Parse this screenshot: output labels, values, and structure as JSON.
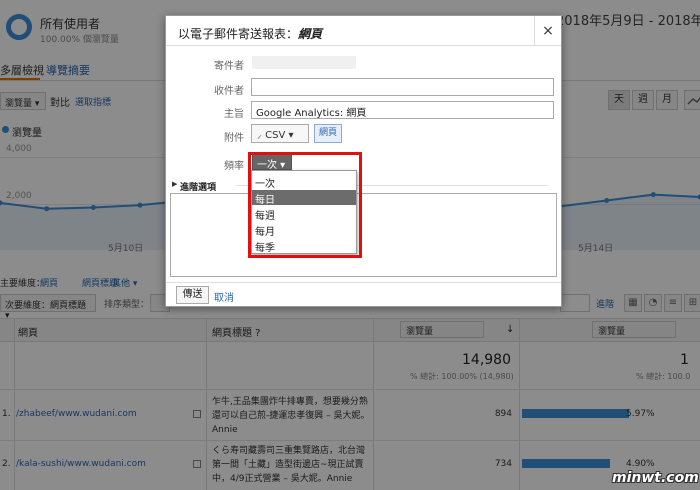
{
  "segment": {
    "name": "所有使用者",
    "subtitle": "100.00% 個瀏覽量"
  },
  "date_range": "2018年5月9日 - 2018年5月",
  "tabs": [
    {
      "label": "多層檢視"
    },
    {
      "label": "導覽摘要"
    }
  ],
  "controls": {
    "metric": "瀏覽量 ▾",
    "versus": "對比",
    "pick_metric": "選取指標"
  },
  "period_buttons": [
    "天",
    "週",
    "月"
  ],
  "chart": {
    "legend": "瀏覽量",
    "y_ticks": [
      "4,000",
      "2,000"
    ],
    "x_ticks": [
      "5月10日",
      "5月14日"
    ]
  },
  "chart_data": {
    "type": "line",
    "series": [
      {
        "name": "瀏覽量",
        "values": [
          2050,
          1800,
          1850,
          1950,
          2150,
          2000,
          1700,
          1900,
          2100,
          2000,
          2100,
          2300,
          1900,
          2150,
          2400,
          2300
        ]
      }
    ],
    "ylim": [
      0,
      4000
    ],
    "x_labels": [
      "5月10日",
      "5月14日"
    ]
  },
  "dimensions": {
    "primary": "主要維度：",
    "dim1": "網頁",
    "dim2": "網頁標題",
    "dim3": "其他 ▾"
  },
  "secondary": {
    "select": "次要維度：網頁標題 ▾",
    "sort_label": "排序類型："
  },
  "advanced_link": "進階",
  "table": {
    "headers": {
      "page": "網頁",
      "title": "網頁標題 ?",
      "metric1": "瀏覽量",
      "metric2": "瀏覽量"
    },
    "total": {
      "value": "14,980",
      "sub": "% 總計: 100.00% (14,980)",
      "sub2": "% 總計: 100.0"
    },
    "rows": [
      {
        "num": "1.",
        "page": "/zhabeef/www.wudani.com",
        "title": "乍牛,王品集團炸牛排專賣，想要幾分熟還可以自己煎-捷運忠孝復興 – 吳大妮。Annie",
        "value": "894",
        "pct": "5.97%",
        "bar": 0.597
      },
      {
        "num": "2.",
        "page": "/kala-sushi/www.wudani.com",
        "title": "くら寿司藏壽司三重集覽路店，北台灣第一間「土藏」造型街邊店~現正試賣中，4/9正式營業 – 吳大妮。Annie",
        "value": "734",
        "pct": "4.90%",
        "bar": 0.49
      }
    ]
  },
  "dialog": {
    "title_prefix": "以電子郵件寄送報表：",
    "title_report": "網頁",
    "close": "×",
    "labels": {
      "sender": "寄件者",
      "recipient": "收件者",
      "subject": "主旨",
      "attachment": "附件",
      "frequency": "頻率"
    },
    "subject_value": "Google Analytics: 網頁",
    "recipient_value": "",
    "attachment_format": "⸝ CSV ▾",
    "attachment_chip": "網頁",
    "frequency_value": "一次 ▾",
    "advanced_options": "進階選項",
    "send": "傳送",
    "cancel": "取消"
  },
  "frequency_menu": [
    "一次",
    "每日",
    "每週",
    "每月",
    "每季"
  ],
  "frequency_selected": 1,
  "watermark": "minwt.com",
  "colors": {
    "accent": "#3b8fd8",
    "link": "#2a67b1",
    "highlight": "#e01010",
    "tab_active": "#e37400"
  }
}
